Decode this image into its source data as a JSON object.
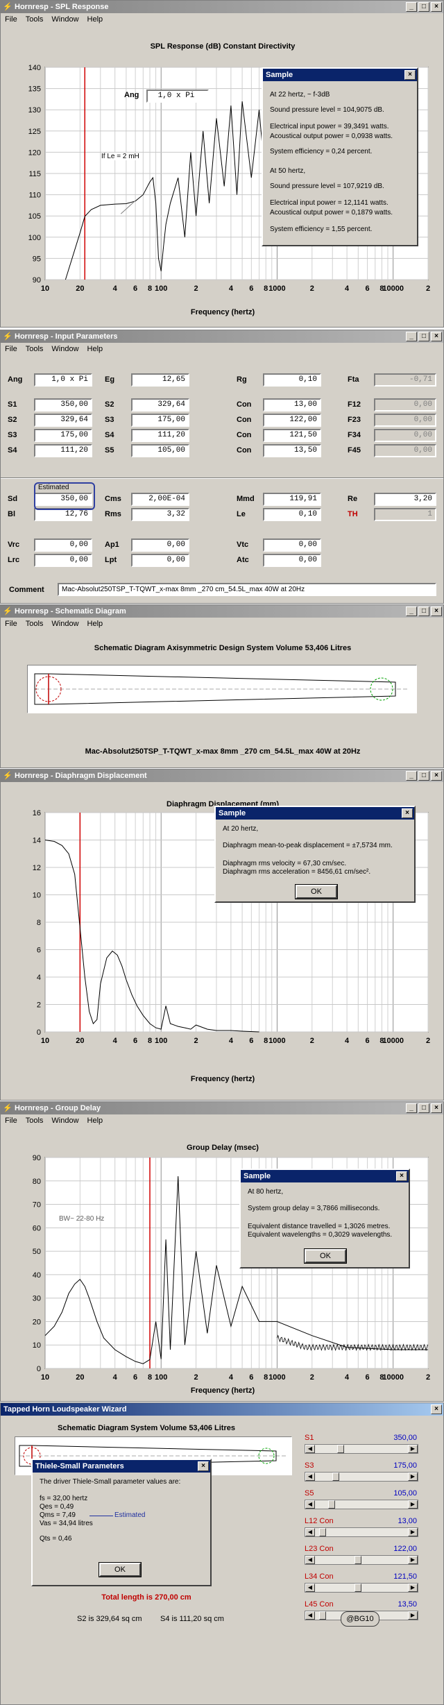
{
  "menu": [
    "File",
    "Tools",
    "Window",
    "Help"
  ],
  "spl": {
    "title": "Hornresp - SPL Response",
    "chart_title": "SPL Response (dB)   Constant Directivity",
    "ang_label": "Ang",
    "ang_value": "1,0 x Pi",
    "annotation": "If Le = 2 mH",
    "xlabel": "Frequency (hertz)",
    "chart_data": {
      "type": "line",
      "title": "SPL Response (dB)   Constant Directivity",
      "xlabel": "Frequency (hertz)",
      "ylabel": "",
      "xscale": "log",
      "xlim": [
        10,
        20000
      ],
      "ylim": [
        90,
        140
      ],
      "yticks": [
        90,
        95,
        100,
        105,
        110,
        115,
        120,
        125,
        130,
        135,
        140
      ],
      "xtick_labels": [
        "10",
        "20",
        "4",
        "6",
        "8",
        "100",
        "2",
        "4",
        "6",
        "8",
        "1000",
        "2",
        "4",
        "6",
        "8",
        "10000",
        "2"
      ],
      "marker_x": 22,
      "series": [
        {
          "x": [
            15,
            18,
            20,
            22,
            25,
            30,
            40,
            50,
            60,
            70,
            80,
            85,
            90,
            95,
            100,
            105,
            110,
            120,
            140,
            160,
            180,
            200,
            230,
            260,
            300,
            350,
            400,
            450,
            500,
            600,
            700,
            800,
            1000
          ],
          "y": [
            90,
            97,
            101,
            104.9,
            106.5,
            107.5,
            107.8,
            107.9,
            108.5,
            110,
            113,
            114,
            108,
            95,
            92,
            98,
            103,
            108,
            114,
            100,
            120,
            105,
            125,
            108,
            128,
            112,
            131,
            110,
            132,
            114,
            130,
            112,
            118
          ]
        }
      ]
    },
    "dialog": {
      "title": "Sample",
      "lines": [
        "At 22 hertz,    ~ f-3dB",
        "Sound pressure level = 104,9075 dB.",
        "Electrical input power = 39,3491 watts.",
        "Acoustical output power = 0,0938 watts.",
        "System efficiency = 0,24 percent.",
        "At 50 hertz,",
        "Sound pressure level = 107,9219 dB.",
        "Electrical input power = 12,1141 watts.",
        "Acoustical output power = 0,1879 watts.",
        "System efficiency = 1,55 percent."
      ]
    }
  },
  "input": {
    "title": "Hornresp - Input Parameters",
    "rows": [
      [
        {
          "l": "Ang",
          "v": "1,0 x Pi"
        },
        {
          "l": "Eg",
          "v": "12,65"
        },
        {
          "l": "Rg",
          "v": "0,10"
        },
        {
          "l": "Fta",
          "v": "-0,71"
        }
      ],
      [
        {
          "l": "S1",
          "v": "350,00"
        },
        {
          "l": "S2",
          "v": "329,64"
        },
        {
          "l": "Con",
          "v": "13,00"
        },
        {
          "l": "F12",
          "v": "0,00"
        }
      ],
      [
        {
          "l": "S2",
          "v": "329,64"
        },
        {
          "l": "S3",
          "v": "175,00"
        },
        {
          "l": "Con",
          "v": "122,00"
        },
        {
          "l": "F23",
          "v": "0,00"
        }
      ],
      [
        {
          "l": "S3",
          "v": "175,00"
        },
        {
          "l": "S4",
          "v": "111,20"
        },
        {
          "l": "Con",
          "v": "121,50"
        },
        {
          "l": "F34",
          "v": "0,00"
        }
      ],
      [
        {
          "l": "S4",
          "v": "111,20"
        },
        {
          "l": "S5",
          "v": "105,00"
        },
        {
          "l": "Con",
          "v": "13,50"
        },
        {
          "l": "F45",
          "v": "0,00"
        }
      ]
    ],
    "estimated": "Estimated",
    "rows2": [
      [
        {
          "l": "Sd",
          "v": "350,00"
        },
        {
          "l": "Cms",
          "v": "2,00E-04"
        },
        {
          "l": "Mmd",
          "v": "119,91"
        },
        {
          "l": "Re",
          "v": "3,20"
        }
      ],
      [
        {
          "l": "Bl",
          "v": "12,76"
        },
        {
          "l": "Rms",
          "v": "3,32"
        },
        {
          "l": "Le",
          "v": "0,10"
        },
        {
          "l": "TH",
          "v": "1"
        }
      ]
    ],
    "rows3": [
      [
        {
          "l": "Vrc",
          "v": "0,00"
        },
        {
          "l": "Ap1",
          "v": "0,00"
        },
        {
          "l": "Vtc",
          "v": "0,00"
        }
      ],
      [
        {
          "l": "Lrc",
          "v": "0,00"
        },
        {
          "l": "Lpt",
          "v": "0,00"
        },
        {
          "l": "Atc",
          "v": "0,00"
        }
      ]
    ],
    "comment_label": "Comment",
    "comment_value": "Mac-Absolut250TSP_T-TQWT_x-max 8mm _270 cm_54.5L_max 40W at 20Hz"
  },
  "schematic": {
    "title": "Hornresp - Schematic Diagram",
    "heading": "Schematic Diagram   Axisymmetric Design   System Volume 53,406 Litres",
    "caption": "Mac-Absolut250TSP_T-TQWT_x-max 8mm _270 cm_54.5L_max 40W at 20Hz"
  },
  "diaphragm": {
    "title": "Hornresp - Diaphragm Displacement",
    "chart_title": "Diaphragm Displacement (mm)",
    "xlabel": "Frequency (hertz)",
    "chart_data": {
      "type": "line",
      "title": "Diaphragm Displacement (mm)",
      "xlabel": "Frequency (hertz)",
      "ylabel": "",
      "xscale": "log",
      "xlim": [
        10,
        20000
      ],
      "ylim": [
        0,
        16
      ],
      "yticks": [
        0,
        2,
        4,
        6,
        8,
        10,
        12,
        14,
        16
      ],
      "xtick_labels": [
        "10",
        "20",
        "4",
        "6",
        "8",
        "100",
        "2",
        "4",
        "6",
        "8",
        "1000",
        "2",
        "4",
        "6",
        "8",
        "10000",
        "2"
      ],
      "marker_x": 20,
      "series": [
        {
          "x": [
            10,
            12,
            14,
            16,
            18,
            20,
            22,
            24,
            26,
            28,
            30,
            34,
            38,
            42,
            46,
            50,
            56,
            62,
            70,
            80,
            90,
            100,
            110,
            120,
            140,
            160,
            180,
            200,
            250,
            300,
            400,
            500,
            700
          ],
          "y": [
            14,
            13.9,
            13.6,
            13,
            11.5,
            7.6,
            4,
            1.5,
            0.6,
            0.9,
            3.5,
            5.4,
            5.9,
            5.6,
            4.8,
            3.8,
            2.7,
            1.9,
            1.2,
            0.6,
            0.3,
            0.2,
            1.9,
            0.6,
            0.4,
            0.3,
            0.2,
            0.5,
            0.2,
            0.1,
            0.1,
            0.05,
            0
          ]
        }
      ]
    },
    "dialog": {
      "title": "Sample",
      "lines": [
        "At 20 hertz,",
        "Diaphragm mean-to-peak displacement = ±7,5734 mm.",
        "Diaphragm rms velocity = 67,30 cm/sec.",
        "Diaphragm rms acceleration = 8456,61 cm/sec²."
      ],
      "ok": "OK"
    }
  },
  "group": {
    "title": "Hornresp - Group Delay",
    "chart_title": "Group Delay (msec)",
    "xlabel": "Frequency (hertz)",
    "annotation": "BW~  22-80 Hz",
    "chart_data": {
      "type": "line",
      "title": "Group Delay (msec)",
      "xlabel": "Frequency (hertz)",
      "ylabel": "",
      "xscale": "log",
      "xlim": [
        10,
        20000
      ],
      "ylim": [
        0,
        90
      ],
      "yticks": [
        0,
        10,
        20,
        30,
        40,
        50,
        60,
        70,
        80,
        90
      ],
      "xtick_labels": [
        "10",
        "20",
        "4",
        "6",
        "8",
        "100",
        "2",
        "4",
        "6",
        "8",
        "1000",
        "2",
        "4",
        "6",
        "8",
        "10000",
        "2"
      ],
      "marker_x": 80,
      "series": [
        {
          "x": [
            10,
            12,
            14,
            16,
            18,
            20,
            22,
            24,
            28,
            32,
            40,
            50,
            60,
            70,
            80,
            90,
            100,
            110,
            120,
            140,
            160,
            200,
            250,
            300,
            400,
            500,
            700,
            1000,
            2000,
            4000,
            10000,
            20000
          ],
          "y": [
            14,
            18,
            24,
            32,
            36,
            38,
            35,
            30,
            20,
            13,
            8,
            5,
            3,
            2,
            3.8,
            20,
            4,
            55,
            8,
            82,
            10,
            50,
            15,
            44,
            18,
            35,
            20,
            20,
            14,
            9,
            8,
            8
          ]
        }
      ]
    },
    "dialog": {
      "title": "Sample",
      "lines": [
        "At 80 hertz,",
        "System group delay = 3,7866 milliseconds.",
        "Equivalent distance travelled = 1,3026 metres.",
        "Equivalent wavelengths = 0,3029 wavelengths."
      ],
      "ok": "OK"
    }
  },
  "wizard": {
    "title": "Tapped Horn Loudspeaker Wizard",
    "heading": "Schematic Diagram   System Volume 53,406 Litres",
    "total_length": "Total length is 270,00 cm",
    "s2": "S2 is 329,64 sq cm",
    "s4": "S4 is 111,20 sq cm",
    "button": "@BG10",
    "sliders": [
      {
        "label": "S1",
        "value": "350,00",
        "level": 0.25
      },
      {
        "label": "S3",
        "value": "175,00",
        "level": 0.2
      },
      {
        "label": "S5",
        "value": "105,00",
        "level": 0.15
      },
      {
        "label": "L12  Con",
        "value": "13,00",
        "level": 0.05
      },
      {
        "label": "L23  Con",
        "value": "122,00",
        "level": 0.45
      },
      {
        "label": "L34  Con",
        "value": "121,50",
        "level": 0.45
      },
      {
        "label": "L45  Con",
        "value": "13,50",
        "level": 0.05
      }
    ],
    "ts_dialog": {
      "title": "Thiele-Small Parameters",
      "intro": "The driver Thiele-Small parameter values are:",
      "lines": [
        "fs = 32,00 hertz",
        "Qes = 0,49",
        "Qms = 7,49",
        "Vas = 34,94 litres",
        "Qts = 0,46"
      ],
      "estimated": "Estimated",
      "ok": "OK"
    }
  }
}
